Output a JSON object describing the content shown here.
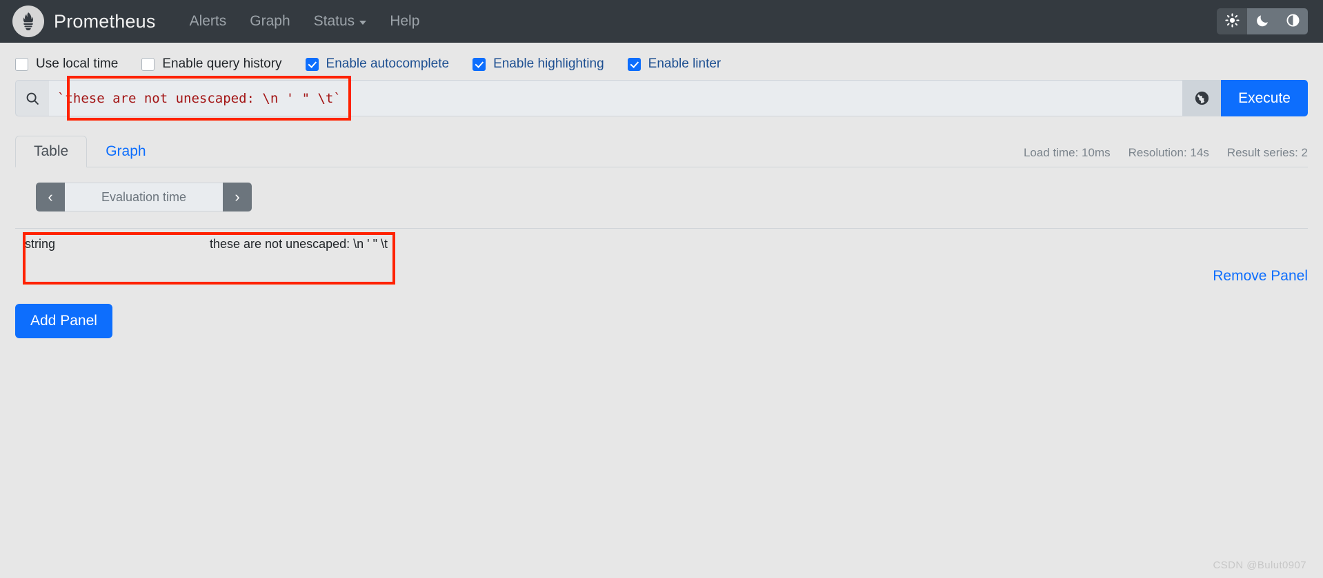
{
  "navbar": {
    "logo_icon": "prometheus-torch-icon",
    "brand": "Prometheus",
    "links": [
      {
        "label": "Alerts",
        "icon": "",
        "has_caret": false
      },
      {
        "label": "Graph",
        "icon": "",
        "has_caret": false
      },
      {
        "label": "Status",
        "icon": "chevron-down-icon",
        "has_caret": true
      },
      {
        "label": "Help",
        "icon": "",
        "has_caret": false
      }
    ],
    "themes": [
      {
        "name": "light-theme-button",
        "icon": "sun-icon",
        "active": true
      },
      {
        "name": "dark-theme-button",
        "icon": "moon-icon",
        "active": false
      },
      {
        "name": "auto-theme-button",
        "icon": "half-circle-icon",
        "active": false
      }
    ]
  },
  "options": [
    {
      "label": "Use local time",
      "checked": false
    },
    {
      "label": "Enable query history",
      "checked": false
    },
    {
      "label": "Enable autocomplete",
      "checked": true
    },
    {
      "label": "Enable highlighting",
      "checked": true
    },
    {
      "label": "Enable linter",
      "checked": true
    }
  ],
  "query": {
    "search_icon": "search-icon",
    "value": "`these are not unescaped: \\n ' \" \\t`",
    "placeholder": "Expression (press Shift+Enter for newlines)",
    "globe_icon": "globe-icon",
    "execute_label": "Execute"
  },
  "panel": {
    "tabs": [
      {
        "label": "Table",
        "active": true
      },
      {
        "label": "Graph",
        "active": false
      }
    ],
    "meta": {
      "load_time": "Load time: 10ms",
      "resolution": "Resolution: 14s",
      "result_series": "Result series: 2"
    },
    "evaluation": {
      "prev_icon": "chevron-left-icon",
      "next_icon": "chevron-right-icon",
      "placeholder": "Evaluation time"
    },
    "results": {
      "rows": [
        {
          "name": "string",
          "value": "these are not unescaped: \\n ' \" \\t"
        }
      ]
    },
    "remove_label": "Remove Panel"
  },
  "add_panel_label": "Add Panel",
  "watermark": "CSDN @Bulut0907",
  "colors": {
    "navbar_bg": "#343a40",
    "page_bg": "#e7e7e7",
    "accent": "#0d6efd",
    "query_text": "#a31515",
    "highlight_box": "#ff2200"
  }
}
